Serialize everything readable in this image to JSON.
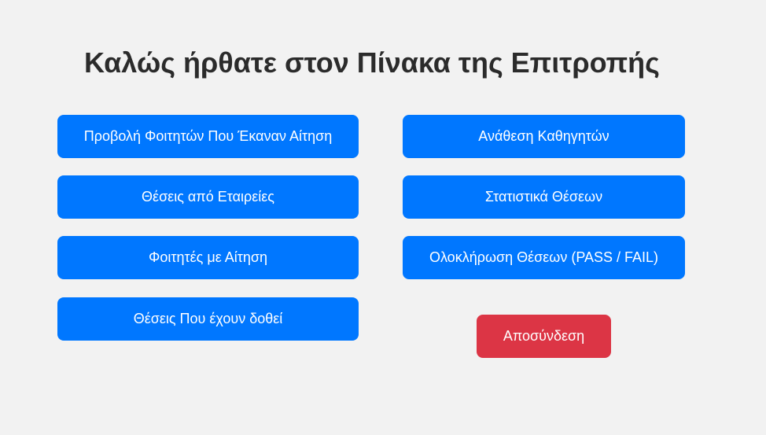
{
  "header": {
    "title": "Καλώς ήρθατε στον Πίνακα της Επιτροπής"
  },
  "actions": {
    "left": [
      "Προβολή Φοιτητών Που Έκαναν Αίτηση",
      "Θέσεις από Εταιρείες",
      "Φοιτητές με Αίτηση",
      "Θέσεις Που έχουν δοθεί"
    ],
    "right": [
      "Ανάθεση Καθηγητών",
      "Στατιστικά Θέσεων",
      "Ολοκλήρωση Θέσεων (PASS / FAIL)"
    ],
    "logout": "Αποσύνδεση"
  },
  "colors": {
    "background": "#f2f2f2",
    "primary": "#0077ff",
    "danger": "#dc3545",
    "title_text": "#2b2b2b",
    "button_text": "#ffffff"
  }
}
